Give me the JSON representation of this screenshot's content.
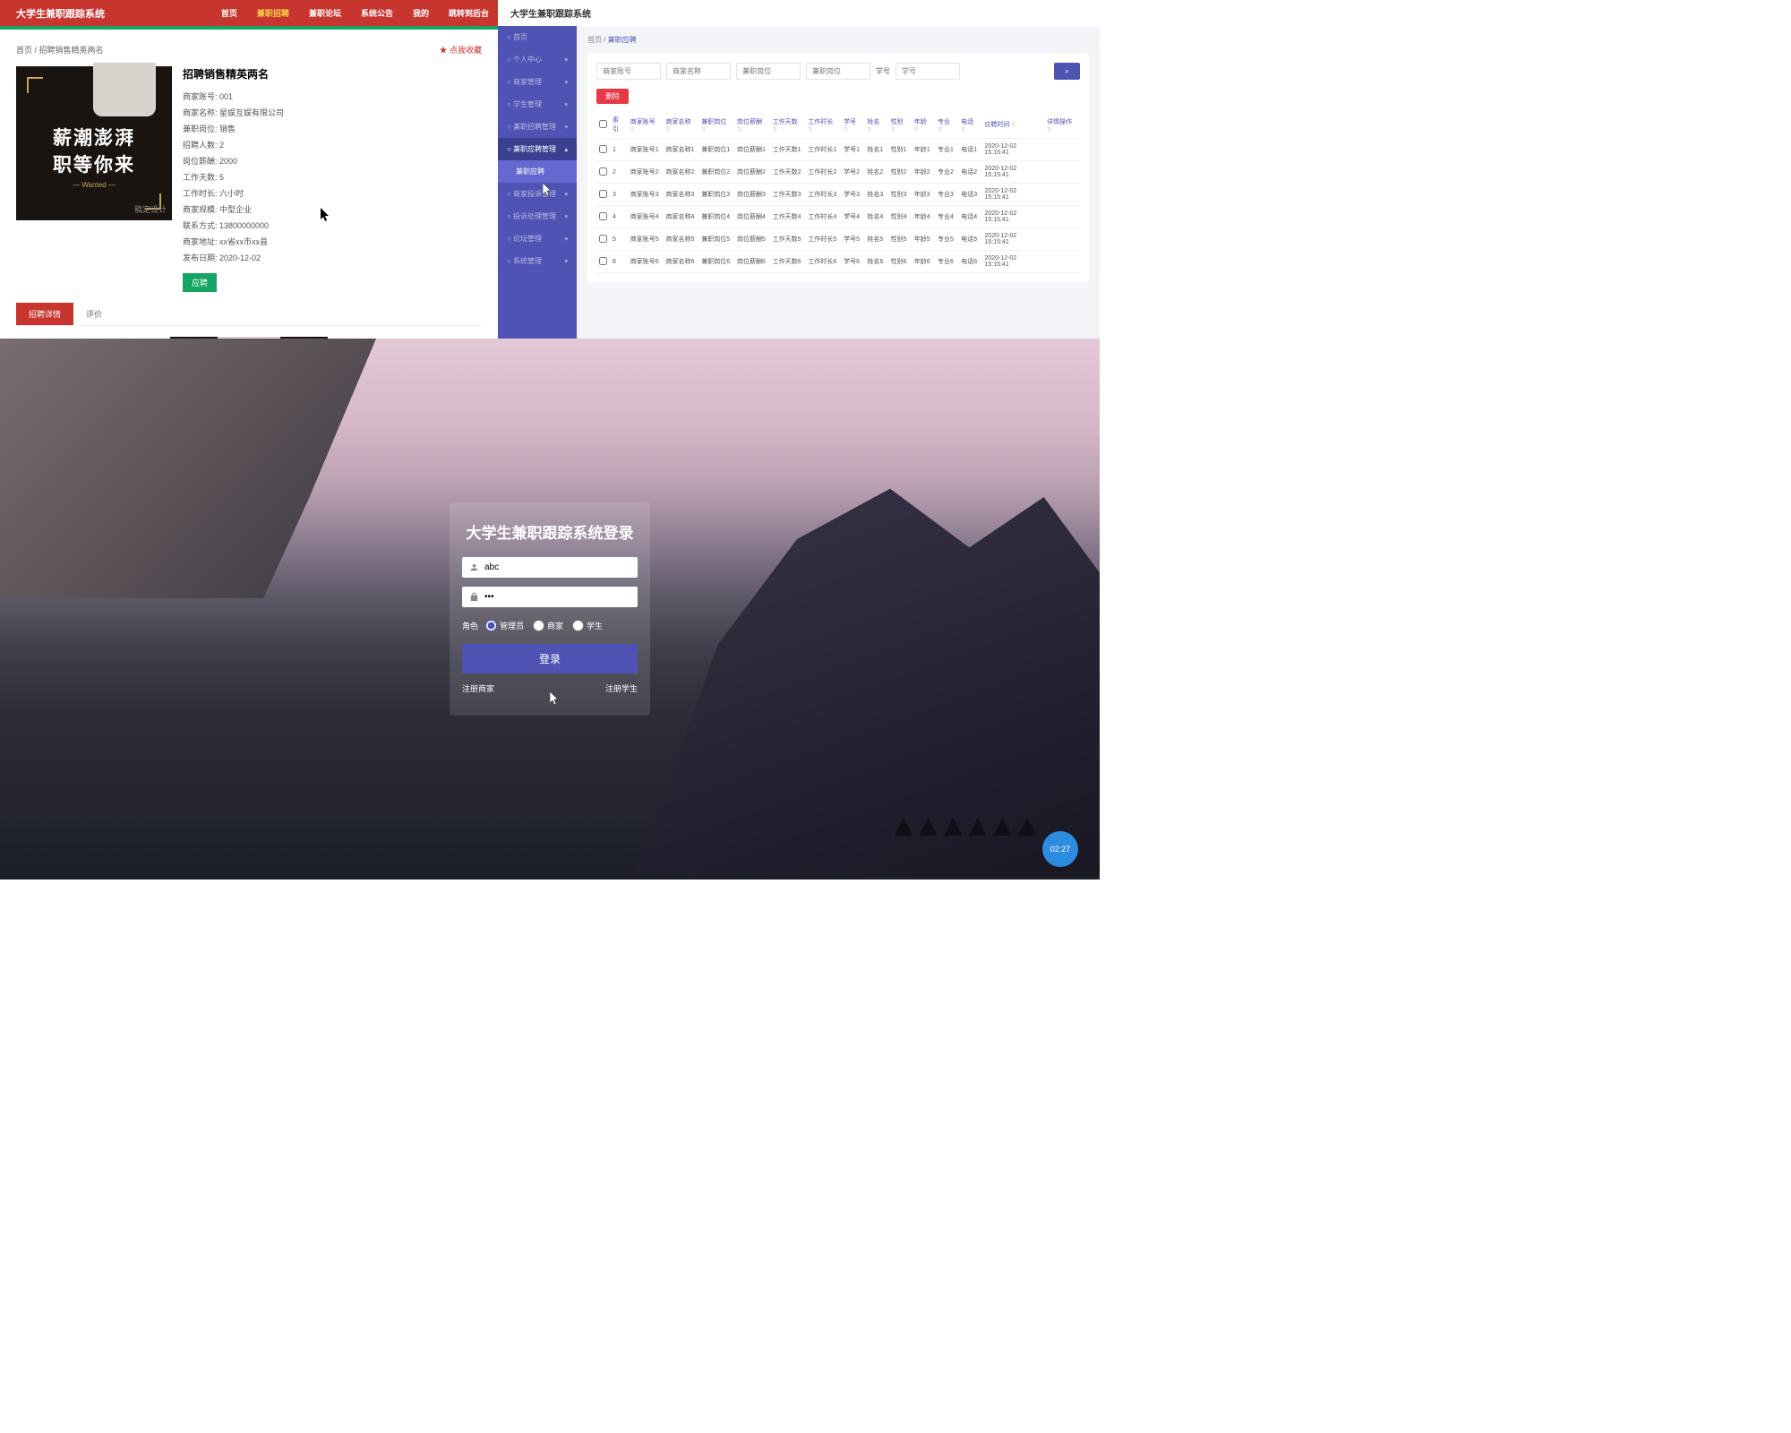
{
  "panel1": {
    "logo": "大学生兼职跟踪系统",
    "nav": [
      "首页",
      "兼职招聘",
      "兼职论坛",
      "系统公告",
      "我的",
      "跳转到后台"
    ],
    "nav_active": 1,
    "breadcrumb": "首页 / 招聘销售精英两名",
    "favorite": "点我收藏",
    "image": {
      "line1": "薪潮澎湃",
      "line2": "职等你来",
      "wanted": "— Wanted —",
      "watermark": "稿定设计"
    },
    "title": "招聘销售精英两名",
    "fields": [
      {
        "label": "商家账号:",
        "value": "001"
      },
      {
        "label": "商家名称:",
        "value": "星娱互娱有限公司"
      },
      {
        "label": "兼职岗位:",
        "value": "销售"
      },
      {
        "label": "招聘人数:",
        "value": "2"
      },
      {
        "label": "岗位薪酬:",
        "value": "2000"
      },
      {
        "label": "工作天数:",
        "value": "5"
      },
      {
        "label": "工作时长:",
        "value": "六小时"
      },
      {
        "label": "商家规模:",
        "value": "中型企业"
      },
      {
        "label": "联系方式:",
        "value": "13800000000"
      },
      {
        "label": "商家地址:",
        "value": "xx省xx市xx县"
      },
      {
        "label": "发布日期:",
        "value": "2020-12-02"
      }
    ],
    "apply": "应聘",
    "tabs": [
      "招聘详情",
      "评价"
    ]
  },
  "panel2": {
    "logo": "大学生兼职跟踪系统",
    "sidebar": [
      {
        "label": "首页",
        "icon": "home"
      },
      {
        "label": "个人中心",
        "icon": "user",
        "chev": "▾"
      },
      {
        "label": "商家管理",
        "icon": "store",
        "chev": "▾"
      },
      {
        "label": "学生管理",
        "icon": "grad",
        "chev": "▾"
      },
      {
        "label": "兼职招聘管理",
        "icon": "list",
        "chev": "▾"
      },
      {
        "label": "兼职应聘管理",
        "icon": "apply",
        "chev": "▴",
        "active": true
      },
      {
        "label": "兼职应聘",
        "sub": true,
        "current": true
      },
      {
        "label": "商家投诉管理",
        "icon": "warn",
        "chev": "▾"
      },
      {
        "label": "投诉处理管理",
        "icon": "proc",
        "chev": "▾"
      },
      {
        "label": "论坛管理",
        "icon": "forum",
        "chev": "▾"
      },
      {
        "label": "系统管理",
        "icon": "sys",
        "chev": "▾"
      }
    ],
    "breadcrumb_home": "首页",
    "breadcrumb_current": "兼职应聘",
    "filters": [
      {
        "placeholder": "商家账号"
      },
      {
        "placeholder": "商家名称"
      },
      {
        "placeholder": "兼职岗位"
      },
      {
        "placeholder": "兼职岗位"
      },
      {
        "label": "学号",
        "placeholder": "学号"
      }
    ],
    "search_icon": "⌕",
    "delete_btn": "删除",
    "columns": [
      "",
      "索引",
      "商家账号",
      "商家名称",
      "兼职岗位",
      "岗位薪酬",
      "工作天数",
      "工作时长",
      "学号",
      "姓名",
      "性别",
      "年龄",
      "专业",
      "电话",
      "应聘时间",
      "详情操作"
    ],
    "rows": [
      {
        "i": 1,
        "a": "商家账号1",
        "b": "商家名称1",
        "c": "兼职岗位1",
        "d": "岗位薪酬1",
        "e": "工作天数1",
        "f": "工作时长1",
        "g": "学号1",
        "h": "姓名1",
        "j": "性别1",
        "k": "年龄1",
        "l": "专业1",
        "m": "电话1",
        "t": "2020-12-02 15:15:41"
      },
      {
        "i": 2,
        "a": "商家账号2",
        "b": "商家名称2",
        "c": "兼职岗位2",
        "d": "岗位薪酬2",
        "e": "工作天数2",
        "f": "工作时长2",
        "g": "学号2",
        "h": "姓名2",
        "j": "性别2",
        "k": "年龄2",
        "l": "专业2",
        "m": "电话2",
        "t": "2020-12-02 15:15:41"
      },
      {
        "i": 3,
        "a": "商家账号3",
        "b": "商家名称3",
        "c": "兼职岗位3",
        "d": "岗位薪酬3",
        "e": "工作天数3",
        "f": "工作时长3",
        "g": "学号3",
        "h": "姓名3",
        "j": "性别3",
        "k": "年龄3",
        "l": "专业3",
        "m": "电话3",
        "t": "2020-12-02 15:15:41"
      },
      {
        "i": 4,
        "a": "商家账号4",
        "b": "商家名称4",
        "c": "兼职岗位4",
        "d": "岗位薪酬4",
        "e": "工作天数4",
        "f": "工作时长4",
        "g": "学号4",
        "h": "姓名4",
        "j": "性别4",
        "k": "年龄4",
        "l": "专业4",
        "m": "电话4",
        "t": "2020-12-02 15:15:41"
      },
      {
        "i": 5,
        "a": "商家账号5",
        "b": "商家名称5",
        "c": "兼职岗位5",
        "d": "岗位薪酬5",
        "e": "工作天数5",
        "f": "工作时长5",
        "g": "学号5",
        "h": "姓名5",
        "j": "性别5",
        "k": "年龄5",
        "l": "专业5",
        "m": "电话5",
        "t": "2020-12-02 15:15:41"
      },
      {
        "i": 6,
        "a": "商家账号6",
        "b": "商家名称6",
        "c": "兼职岗位6",
        "d": "岗位薪酬6",
        "e": "工作天数6",
        "f": "工作时长6",
        "g": "学号6",
        "h": "姓名6",
        "j": "性别6",
        "k": "年龄6",
        "l": "专业6",
        "m": "电话6",
        "t": "2020-12-02 15:15:41"
      }
    ]
  },
  "panel3": {
    "title": "大学生兼职跟踪系统登录",
    "username": "abc",
    "password": "•••",
    "role_label": "角色",
    "roles": [
      "管理员",
      "商家",
      "学生"
    ],
    "role_selected": 0,
    "login_btn": "登录",
    "reg_merchant": "注册商家",
    "reg_student": "注册学生",
    "timer": "02:27"
  }
}
